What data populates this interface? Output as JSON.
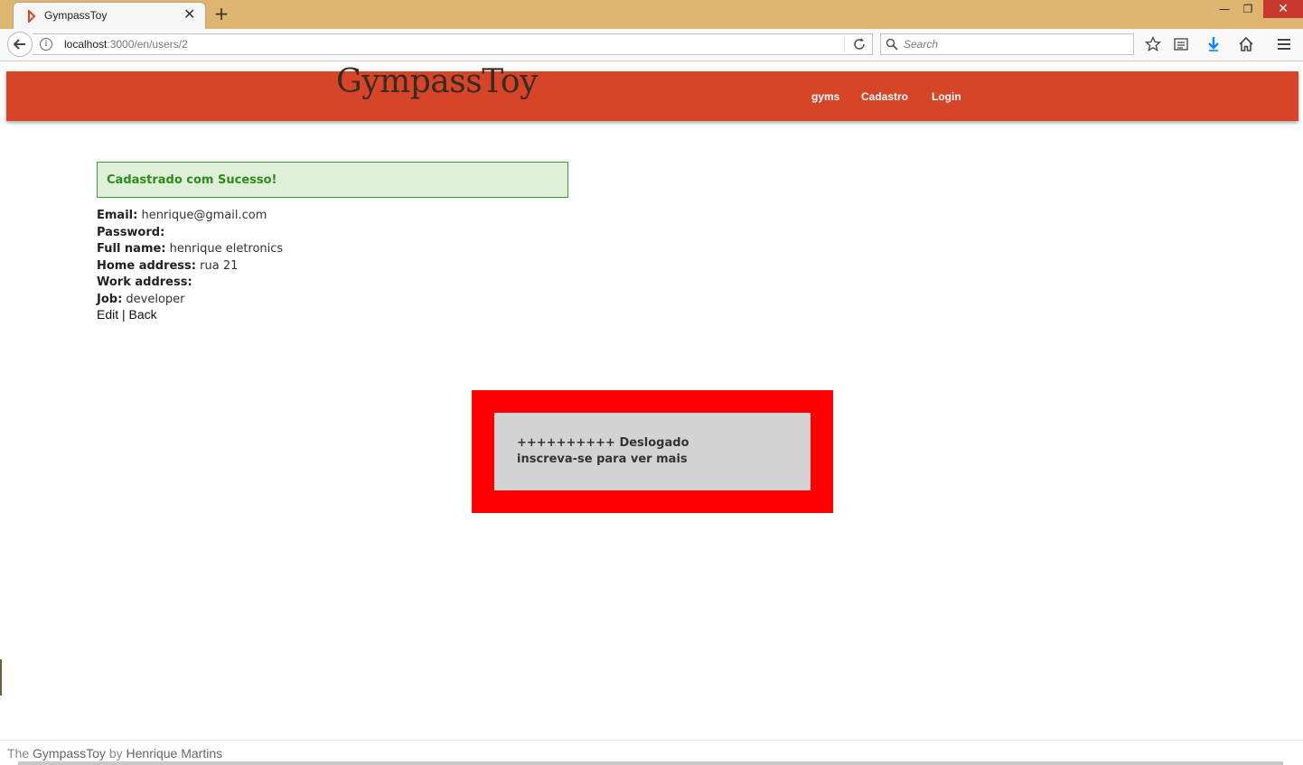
{
  "browser": {
    "tab_title": "GympassToy",
    "url_host": "localhost",
    "url_path": ":3000/en/users/2",
    "search_placeholder": "Search"
  },
  "site": {
    "logo": "GympassToy",
    "nav": [
      {
        "label": "gyms"
      },
      {
        "label": "Cadastro"
      },
      {
        "label": "Login"
      }
    ]
  },
  "notice": "Cadastrado com Sucesso!",
  "user": {
    "fields": [
      {
        "label": "Email:",
        "value": "henrique@gmail.com"
      },
      {
        "label": "Password:",
        "value": ""
      },
      {
        "label": "Full name:",
        "value": "henrique eletronics"
      },
      {
        "label": "Home address:",
        "value": "rua 21"
      },
      {
        "label": "Work address:",
        "value": ""
      },
      {
        "label": "Job:",
        "value": "developer"
      }
    ],
    "edit_label": "Edit",
    "separator": "|",
    "back_label": "Back"
  },
  "logout_box": {
    "line1": "++++++++++ Deslogado",
    "line2": "inscreva-se para ver mais",
    "outer_color": "#ff0000",
    "inner_color": "#d3d3d3"
  },
  "footer": {
    "prefix": "The",
    "app": "GympassToy",
    "by": "by",
    "author": "Henrique Martins"
  },
  "colors": {
    "header": "#d64527",
    "titlebar": "#deb471",
    "notice_bg": "#dff0d8",
    "notice_text": "#2e8a1e"
  }
}
